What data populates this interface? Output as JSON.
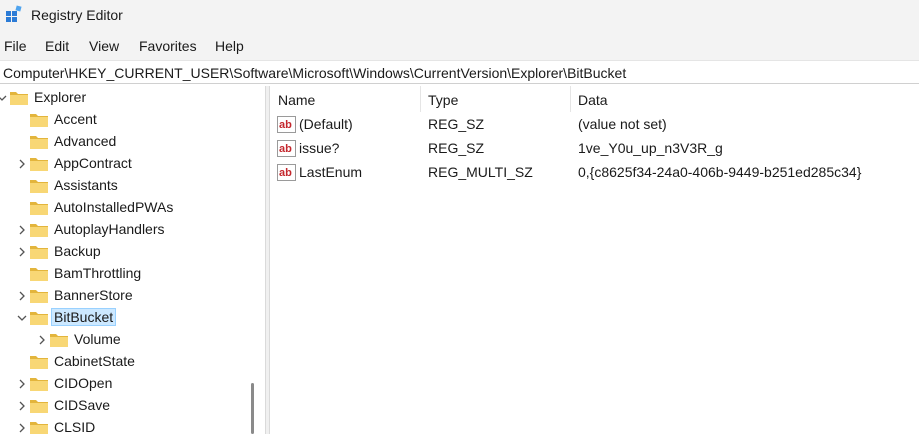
{
  "window": {
    "title": "Registry Editor"
  },
  "menu": [
    "File",
    "Edit",
    "View",
    "Favorites",
    "Help"
  ],
  "address": {
    "path": "Computer\\HKEY_CURRENT_USER\\Software\\Microsoft\\Windows\\CurrentVersion\\Explorer\\BitBucket"
  },
  "tree": {
    "items": [
      {
        "label": "Explorer",
        "depth": 0,
        "chevron": "expanded"
      },
      {
        "label": "Accent",
        "depth": 1,
        "chevron": "none"
      },
      {
        "label": "Advanced",
        "depth": 1,
        "chevron": "none"
      },
      {
        "label": "AppContract",
        "depth": 1,
        "chevron": "collapsed"
      },
      {
        "label": "Assistants",
        "depth": 1,
        "chevron": "none"
      },
      {
        "label": "AutoInstalledPWAs",
        "depth": 1,
        "chevron": "none"
      },
      {
        "label": "AutoplayHandlers",
        "depth": 1,
        "chevron": "collapsed"
      },
      {
        "label": "Backup",
        "depth": 1,
        "chevron": "collapsed"
      },
      {
        "label": "BamThrottling",
        "depth": 1,
        "chevron": "none"
      },
      {
        "label": "BannerStore",
        "depth": 1,
        "chevron": "collapsed"
      },
      {
        "label": "BitBucket",
        "depth": 1,
        "chevron": "expanded",
        "selected": true
      },
      {
        "label": "Volume",
        "depth": 2,
        "chevron": "collapsed"
      },
      {
        "label": "CabinetState",
        "depth": 1,
        "chevron": "none"
      },
      {
        "label": "CIDOpen",
        "depth": 1,
        "chevron": "collapsed"
      },
      {
        "label": "CIDSave",
        "depth": 1,
        "chevron": "collapsed"
      },
      {
        "label": "CLSID",
        "depth": 1,
        "chevron": "collapsed"
      }
    ]
  },
  "list": {
    "columns": {
      "name": "Name",
      "type": "Type",
      "data": "Data"
    },
    "rows": [
      {
        "name": "(Default)",
        "type": "REG_SZ",
        "data": "(value not set)",
        "icon": "string-value-icon"
      },
      {
        "name": "issue?",
        "type": "REG_SZ",
        "data": "1ve_Y0u_up_n3V3R_g",
        "icon": "string-value-icon"
      },
      {
        "name": "LastEnum",
        "type": "REG_MULTI_SZ",
        "data": "0,{c8625f34-24a0-406b-9449-b251ed285c34}",
        "icon": "string-value-icon"
      }
    ]
  },
  "colors": {
    "folder": "#f8d775",
    "folder_dark": "#e3b53c",
    "selection": "#cce8ff",
    "selection_border": "#99d1ff",
    "ab_red": "#c4282e"
  }
}
